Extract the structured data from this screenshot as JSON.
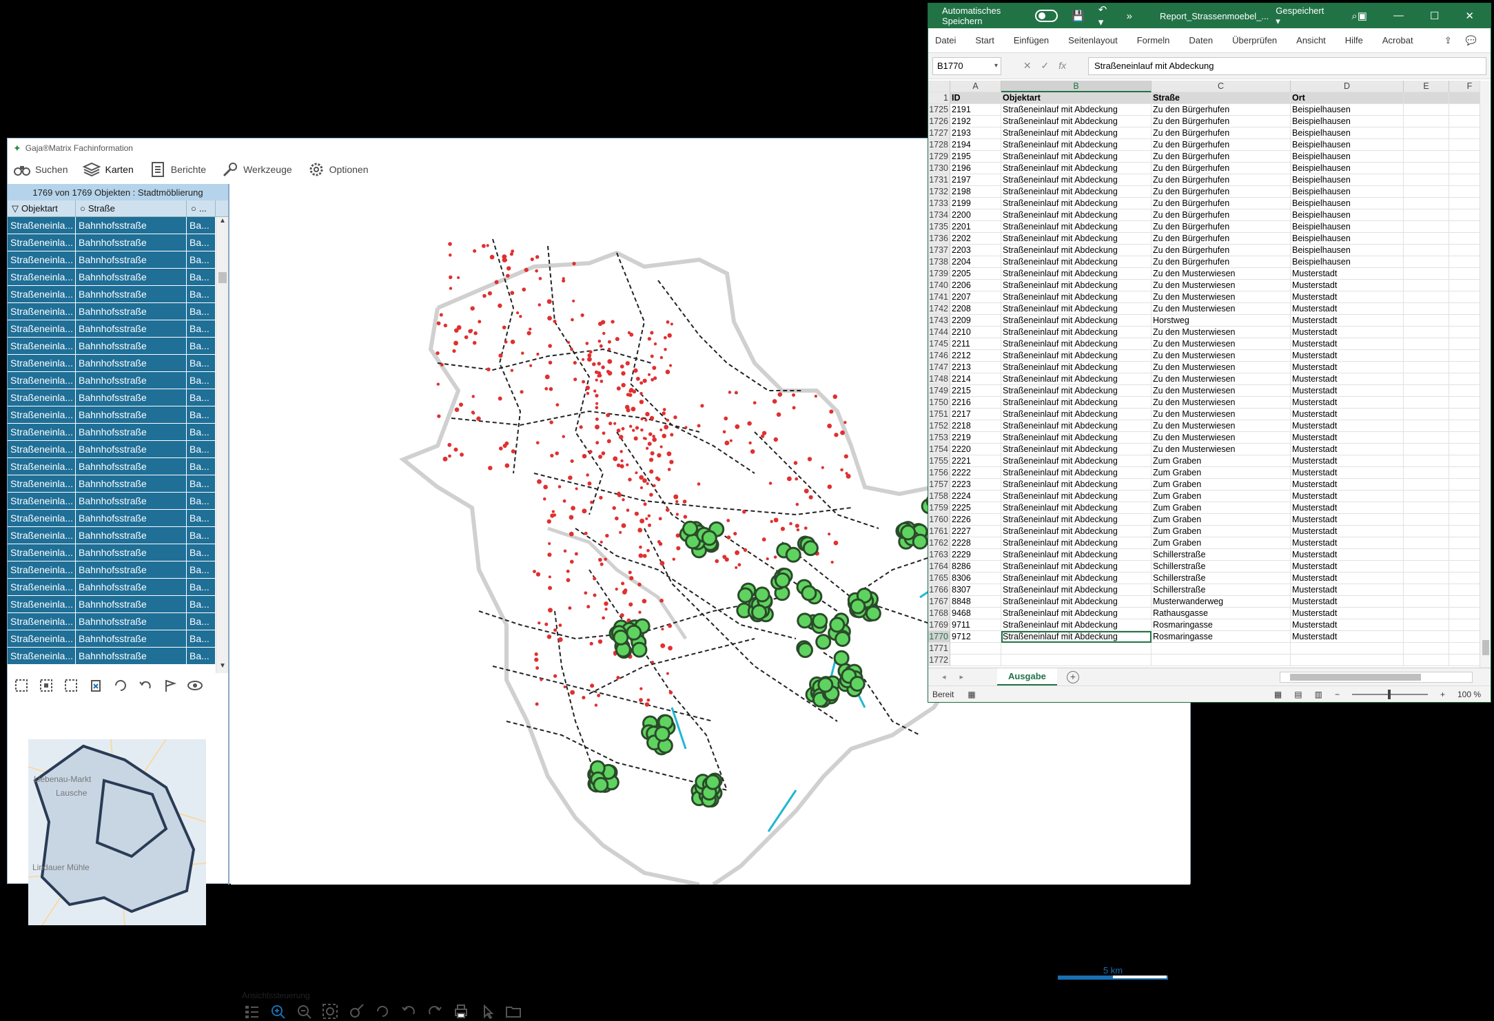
{
  "gaja": {
    "title": "Gaja®Matrix Fachinformation",
    "menu": [
      {
        "label": "Suchen",
        "icon": "binoculars-icon"
      },
      {
        "label": "Karten",
        "icon": "layers-icon"
      },
      {
        "label": "Berichte",
        "icon": "report-icon"
      },
      {
        "label": "Werkzeuge",
        "icon": "wrench-icon"
      },
      {
        "label": "Optionen",
        "icon": "gear-icon"
      }
    ],
    "object_count": "1769 von 1769 Objekten : Stadtmöblierung",
    "table_headers": [
      "Objektart",
      "Straße",
      "..."
    ],
    "row_cells": [
      "Straßeneinla...",
      "Bahnhofsstraße",
      "Ba..."
    ],
    "visible_rows": 26,
    "view_control_label": "Ansichtssteuerung",
    "scale_label": "5 km",
    "overview_labels": [
      "Liebenau-Markt",
      "Lausche",
      "Lindauer Mühle"
    ]
  },
  "excel": {
    "autosave_label": "Automatisches Speichern",
    "doc_name": "Report_Strassenmoebel_...",
    "saved_state": "Gespeichert",
    "ribbon": [
      "Datei",
      "Start",
      "Einfügen",
      "Seitenlayout",
      "Formeln",
      "Daten",
      "Überprüfen",
      "Ansicht",
      "Hilfe",
      "Acrobat"
    ],
    "name_box": "B1770",
    "formula_value": "Straßeneinlauf mit Abdeckung",
    "columns": [
      "A",
      "B",
      "C",
      "D",
      "E",
      "F"
    ],
    "header_row": {
      "row": "1",
      "cells": [
        "ID",
        "Objektart",
        "Straße",
        "Ort"
      ]
    },
    "rows": [
      [
        "1725",
        "2191",
        "Straßeneinlauf mit Abdeckung",
        "Zu den Bürgerhufen",
        "Beispielhausen"
      ],
      [
        "1726",
        "2192",
        "Straßeneinlauf mit Abdeckung",
        "Zu den Bürgerhufen",
        "Beispielhausen"
      ],
      [
        "1727",
        "2193",
        "Straßeneinlauf mit Abdeckung",
        "Zu den Bürgerhufen",
        "Beispielhausen"
      ],
      [
        "1728",
        "2194",
        "Straßeneinlauf mit Abdeckung",
        "Zu den Bürgerhufen",
        "Beispielhausen"
      ],
      [
        "1729",
        "2195",
        "Straßeneinlauf mit Abdeckung",
        "Zu den Bürgerhufen",
        "Beispielhausen"
      ],
      [
        "1730",
        "2196",
        "Straßeneinlauf mit Abdeckung",
        "Zu den Bürgerhufen",
        "Beispielhausen"
      ],
      [
        "1731",
        "2197",
        "Straßeneinlauf mit Abdeckung",
        "Zu den Bürgerhufen",
        "Beispielhausen"
      ],
      [
        "1732",
        "2198",
        "Straßeneinlauf mit Abdeckung",
        "Zu den Bürgerhufen",
        "Beispielhausen"
      ],
      [
        "1733",
        "2199",
        "Straßeneinlauf mit Abdeckung",
        "Zu den Bürgerhufen",
        "Beispielhausen"
      ],
      [
        "1734",
        "2200",
        "Straßeneinlauf mit Abdeckung",
        "Zu den Bürgerhufen",
        "Beispielhausen"
      ],
      [
        "1735",
        "2201",
        "Straßeneinlauf mit Abdeckung",
        "Zu den Bürgerhufen",
        "Beispielhausen"
      ],
      [
        "1736",
        "2202",
        "Straßeneinlauf mit Abdeckung",
        "Zu den Bürgerhufen",
        "Beispielhausen"
      ],
      [
        "1737",
        "2203",
        "Straßeneinlauf mit Abdeckung",
        "Zu den Bürgerhufen",
        "Beispielhausen"
      ],
      [
        "1738",
        "2204",
        "Straßeneinlauf mit Abdeckung",
        "Zu den Bürgerhufen",
        "Beispielhausen"
      ],
      [
        "1739",
        "2205",
        "Straßeneinlauf mit Abdeckung",
        "Zu den Musterwiesen",
        "Musterstadt"
      ],
      [
        "1740",
        "2206",
        "Straßeneinlauf mit Abdeckung",
        "Zu den Musterwiesen",
        "Musterstadt"
      ],
      [
        "1741",
        "2207",
        "Straßeneinlauf mit Abdeckung",
        "Zu den Musterwiesen",
        "Musterstadt"
      ],
      [
        "1742",
        "2208",
        "Straßeneinlauf mit Abdeckung",
        "Zu den Musterwiesen",
        "Musterstadt"
      ],
      [
        "1743",
        "2209",
        "Straßeneinlauf mit Abdeckung",
        "Horstweg",
        "Musterstadt"
      ],
      [
        "1744",
        "2210",
        "Straßeneinlauf mit Abdeckung",
        "Zu den Musterwiesen",
        "Musterstadt"
      ],
      [
        "1745",
        "2211",
        "Straßeneinlauf mit Abdeckung",
        "Zu den Musterwiesen",
        "Musterstadt"
      ],
      [
        "1746",
        "2212",
        "Straßeneinlauf mit Abdeckung",
        "Zu den Musterwiesen",
        "Musterstadt"
      ],
      [
        "1747",
        "2213",
        "Straßeneinlauf mit Abdeckung",
        "Zu den Musterwiesen",
        "Musterstadt"
      ],
      [
        "1748",
        "2214",
        "Straßeneinlauf mit Abdeckung",
        "Zu den Musterwiesen",
        "Musterstadt"
      ],
      [
        "1749",
        "2215",
        "Straßeneinlauf mit Abdeckung",
        "Zu den Musterwiesen",
        "Musterstadt"
      ],
      [
        "1750",
        "2216",
        "Straßeneinlauf mit Abdeckung",
        "Zu den Musterwiesen",
        "Musterstadt"
      ],
      [
        "1751",
        "2217",
        "Straßeneinlauf mit Abdeckung",
        "Zu den Musterwiesen",
        "Musterstadt"
      ],
      [
        "1752",
        "2218",
        "Straßeneinlauf mit Abdeckung",
        "Zu den Musterwiesen",
        "Musterstadt"
      ],
      [
        "1753",
        "2219",
        "Straßeneinlauf mit Abdeckung",
        "Zu den Musterwiesen",
        "Musterstadt"
      ],
      [
        "1754",
        "2220",
        "Straßeneinlauf mit Abdeckung",
        "Zu den Musterwiesen",
        "Musterstadt"
      ],
      [
        "1755",
        "2221",
        "Straßeneinlauf mit Abdeckung",
        "Zum Graben",
        "Musterstadt"
      ],
      [
        "1756",
        "2222",
        "Straßeneinlauf mit Abdeckung",
        "Zum Graben",
        "Musterstadt"
      ],
      [
        "1757",
        "2223",
        "Straßeneinlauf mit Abdeckung",
        "Zum Graben",
        "Musterstadt"
      ],
      [
        "1758",
        "2224",
        "Straßeneinlauf mit Abdeckung",
        "Zum Graben",
        "Musterstadt"
      ],
      [
        "1759",
        "2225",
        "Straßeneinlauf mit Abdeckung",
        "Zum Graben",
        "Musterstadt"
      ],
      [
        "1760",
        "2226",
        "Straßeneinlauf mit Abdeckung",
        "Zum Graben",
        "Musterstadt"
      ],
      [
        "1761",
        "2227",
        "Straßeneinlauf mit Abdeckung",
        "Zum Graben",
        "Musterstadt"
      ],
      [
        "1762",
        "2228",
        "Straßeneinlauf mit Abdeckung",
        "Zum Graben",
        "Musterstadt"
      ],
      [
        "1763",
        "2229",
        "Straßeneinlauf mit Abdeckung",
        "Schillerstraße",
        "Musterstadt"
      ],
      [
        "1764",
        "8286",
        "Straßeneinlauf mit Abdeckung",
        "Schillerstraße",
        "Musterstadt"
      ],
      [
        "1765",
        "8306",
        "Straßeneinlauf mit Abdeckung",
        "Schillerstraße",
        "Musterstadt"
      ],
      [
        "1766",
        "8307",
        "Straßeneinlauf mit Abdeckung",
        "Schillerstraße",
        "Musterstadt"
      ],
      [
        "1767",
        "8848",
        "Straßeneinlauf mit Abdeckung",
        "Musterwanderweg",
        "Musterstadt"
      ],
      [
        "1768",
        "9468",
        "Straßeneinlauf mit Abdeckung",
        "Rathausgasse",
        "Musterstadt"
      ],
      [
        "1769",
        "9711",
        "Straßeneinlauf mit Abdeckung",
        "Rosmaringasse",
        "Musterstadt"
      ],
      [
        "1770",
        "9712",
        "Straßeneinlauf mit Abdeckung",
        "Rosmaringasse",
        "Musterstadt"
      ],
      [
        "1771",
        "",
        "",
        "",
        ""
      ],
      [
        "1772",
        "",
        "",
        "",
        ""
      ]
    ],
    "active_row": "1770",
    "sheet_tab": "Ausgabe",
    "status_ready": "Bereit",
    "zoom": "100 %"
  }
}
